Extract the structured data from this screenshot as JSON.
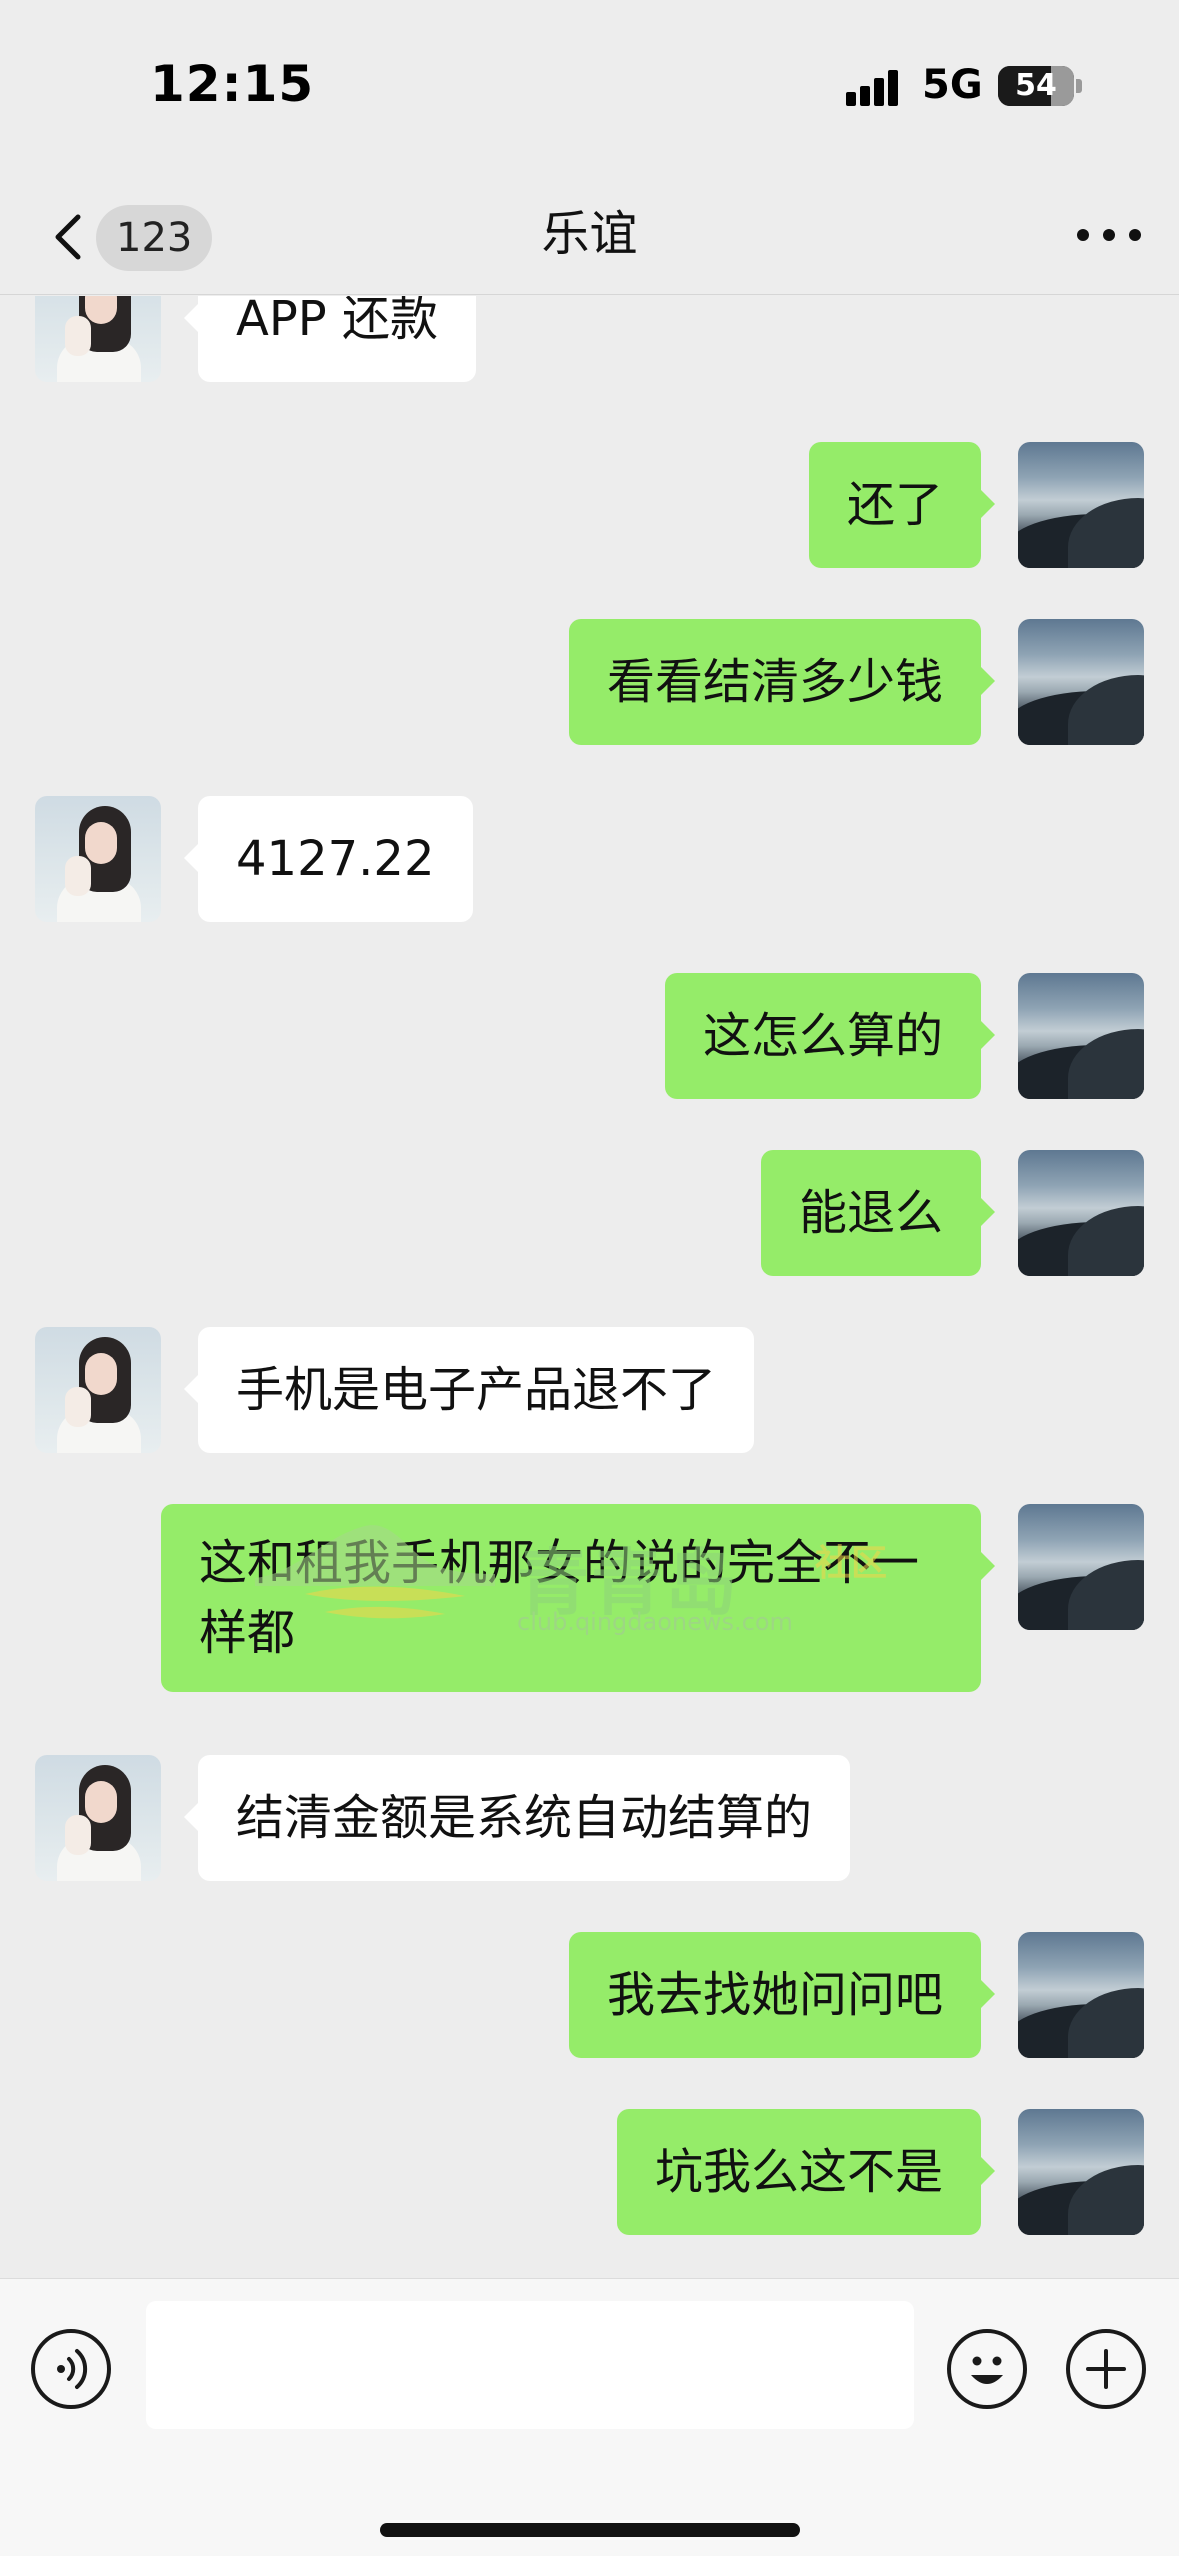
{
  "status_bar": {
    "time": "12:15",
    "network": "5G",
    "battery": "54",
    "battery_level_percent": 54
  },
  "nav": {
    "unread_count": "123",
    "title": "乐谊"
  },
  "messages": [
    {
      "side": "incoming",
      "text": "APP 还款"
    },
    {
      "side": "outgoing",
      "text": "还了"
    },
    {
      "side": "outgoing",
      "text": "看看结清多少钱"
    },
    {
      "side": "incoming",
      "text": "4127.22"
    },
    {
      "side": "outgoing",
      "text": "这怎么算的"
    },
    {
      "side": "outgoing",
      "text": "能退么"
    },
    {
      "side": "incoming",
      "text": "手机是电子产品退不了"
    },
    {
      "side": "outgoing",
      "text": "这和租我手机那女的说的完全不一样都"
    },
    {
      "side": "incoming",
      "text": "结清金额是系统自动结算的"
    },
    {
      "side": "outgoing",
      "text": "我去找她问问吧"
    },
    {
      "side": "outgoing",
      "text": "坑我么这不是"
    }
  ],
  "watermark": {
    "title": "青青岛",
    "subtitle": "社区",
    "url": "club.qingdaonews.com"
  },
  "input": {
    "value": "",
    "placeholder": ""
  },
  "icons": {
    "back": "chevron-left-icon",
    "more": "more-icon",
    "voice": "voice-icon",
    "emoji": "emoji-icon",
    "plus": "plus-icon"
  },
  "colors": {
    "background": "#ededed",
    "outgoing_bubble": "#95ec69",
    "incoming_bubble": "#ffffff",
    "badge": "#d7d7d7"
  }
}
